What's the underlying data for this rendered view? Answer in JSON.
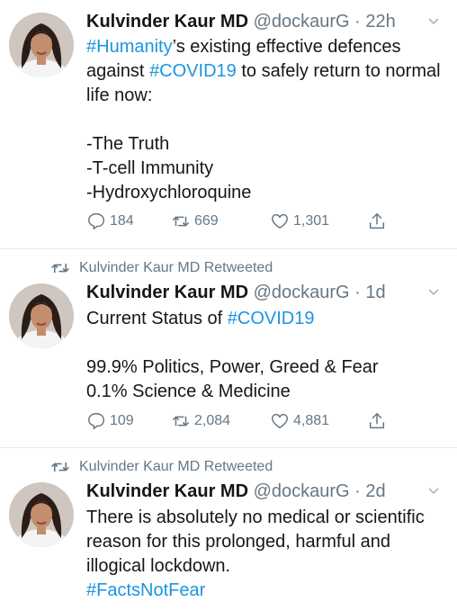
{
  "tweets": [
    {
      "retweeted_by": "",
      "name": "Kulvinder Kaur MD",
      "handle": "@dockaurG",
      "separator": "·",
      "time": "22h",
      "body": {
        "tag1": "#Humanity",
        "text1": "’s existing effective defences against ",
        "tag2": "#COVID19",
        "text2": " to safely return to normal life now:\n\n-The Truth\n-T-cell Immunity\n-Hydroxychloroquine"
      },
      "replies": "184",
      "retweets": "669",
      "likes": "1,301"
    },
    {
      "retweeted_by": "Kulvinder Kaur MD Retweeted",
      "name": "Kulvinder Kaur MD",
      "handle": "@dockaurG",
      "separator": "·",
      "time": "1d",
      "body": {
        "text1": "Current Status of ",
        "tag1": "#COVID19",
        "text2": "\n\n99.9% Politics, Power, Greed & Fear\n0.1% Science & Medicine"
      },
      "replies": "109",
      "retweets": "2,084",
      "likes": "4,881"
    },
    {
      "retweeted_by": "Kulvinder Kaur MD Retweeted",
      "name": "Kulvinder Kaur MD",
      "handle": "@dockaurG",
      "separator": "·",
      "time": "2d",
      "body": {
        "text1": "There is absolutely no medical or scientific reason for this prolonged, harmful and illogical lockdown.\n",
        "tag1": "#FactsNotFear"
      }
    }
  ],
  "colors": {
    "link": "#1b95e0",
    "muted": "#657786",
    "divider": "#e6ecf0"
  },
  "icons": [
    "retweet-icon",
    "reply-icon",
    "like-icon",
    "share-icon",
    "chevron-down-icon"
  ]
}
